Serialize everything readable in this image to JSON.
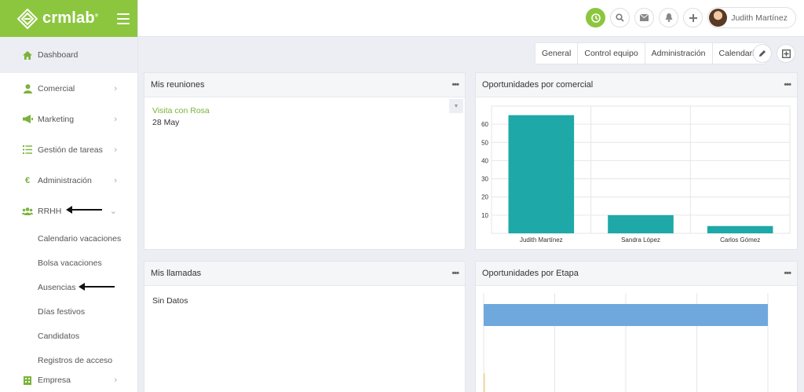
{
  "brand": {
    "name": "crmlab",
    "mark": "®"
  },
  "sidebar": {
    "items": [
      {
        "label": "Dashboard",
        "icon": "home-icon"
      },
      {
        "label": "Comercial",
        "icon": "user-icon"
      },
      {
        "label": "Marketing",
        "icon": "megaphone-icon"
      },
      {
        "label": "Gestión de tareas",
        "icon": "task-list-icon"
      },
      {
        "label": "Administración",
        "icon": "euro-icon"
      },
      {
        "label": "RRHH",
        "icon": "users-icon"
      },
      {
        "label": "Empresa",
        "icon": "building-icon"
      }
    ],
    "rrhh_sub": [
      {
        "label": "Calendario vacaciones"
      },
      {
        "label": "Bolsa vacaciones"
      },
      {
        "label": "Ausencias"
      },
      {
        "label": "Días festivos"
      },
      {
        "label": "Candidatos"
      },
      {
        "label": "Registros de acceso"
      }
    ]
  },
  "topbar": {
    "user_name": "Judith Martínez"
  },
  "tabs": [
    "General",
    "Control equipo",
    "Administración",
    "Calendario"
  ],
  "panels": {
    "meetings": {
      "title": "Mis reuniones",
      "item_title": "Visita con Rosa",
      "item_date": "28 May"
    },
    "calls": {
      "title": "Mis llamadas",
      "empty": "Sin Datos"
    },
    "by_salesperson": {
      "title": "Oportunidades por comercial"
    },
    "by_stage": {
      "title": "Oportunidades por Etapa"
    }
  },
  "colors": {
    "brand": "#8cc63f",
    "bar_teal": "#1ea8a8",
    "bar_blue": "#6fa8dc"
  },
  "chart_data": [
    {
      "type": "bar",
      "categories": [
        "Judith Martínez",
        "Sandra López",
        "Carlos Gómez"
      ],
      "values": [
        65,
        10,
        4
      ],
      "ylim": [
        0,
        70
      ],
      "yticks": [
        10,
        20,
        30,
        40,
        50,
        60
      ],
      "grid": true
    },
    {
      "type": "bar",
      "orientation": "horizontal",
      "values": [
        1
      ],
      "xlim": [
        0,
        1
      ],
      "grid": true
    }
  ]
}
